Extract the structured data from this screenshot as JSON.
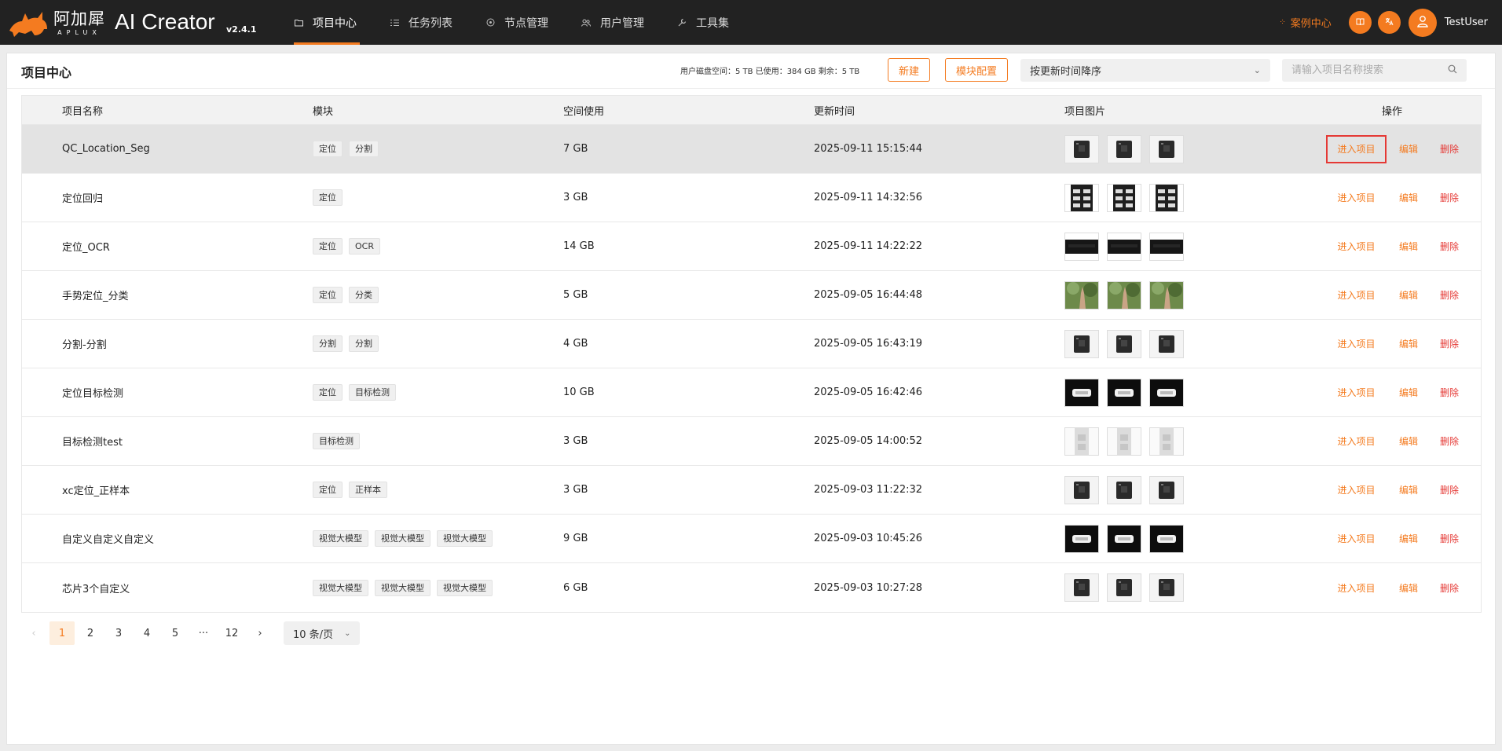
{
  "app": {
    "logo_cn": "阿加犀",
    "logo_en": "APLUX",
    "name": "AI Creator",
    "version": "v2.4.1"
  },
  "nav": [
    {
      "label": "项目中心",
      "icon": "folder-icon",
      "active": true
    },
    {
      "label": "任务列表",
      "icon": "list-icon",
      "active": false
    },
    {
      "label": "节点管理",
      "icon": "node-icon",
      "active": false
    },
    {
      "label": "用户管理",
      "icon": "users-icon",
      "active": false
    },
    {
      "label": "工具集",
      "icon": "wrench-icon",
      "active": false
    }
  ],
  "header_right": {
    "case_center": "案例中心",
    "username": "TestUser"
  },
  "page": {
    "title": "项目中心",
    "disk_info": "用户磁盘空间：5 TB  已使用：384 GB  剩余：5 TB",
    "new_button": "新建",
    "module_config_button": "模块配置",
    "sort_value": "按更新时间降序",
    "search_placeholder": "请输入项目名称搜索"
  },
  "table": {
    "headers": {
      "name": "项目名称",
      "modules": "模块",
      "space": "空间使用",
      "updated": "更新时间",
      "images": "项目图片",
      "actions": "操作"
    },
    "action_labels": {
      "enter": "进入项目",
      "edit": "编辑",
      "delete": "删除"
    },
    "rows": [
      {
        "name": "QC_Location_Seg",
        "modules": [
          "定位",
          "分割"
        ],
        "space": "7 GB",
        "updated": "2025-09-11 15:15:44",
        "thumb": "chip"
      },
      {
        "name": "定位回归",
        "modules": [
          "定位"
        ],
        "space": "3 GB",
        "updated": "2025-09-11 14:32:56",
        "thumb": "tray"
      },
      {
        "name": "定位_OCR",
        "modules": [
          "定位",
          "OCR"
        ],
        "space": "14 GB",
        "updated": "2025-09-11 14:22:22",
        "thumb": "dark"
      },
      {
        "name": "手势定位_分类",
        "modules": [
          "定位",
          "分类"
        ],
        "space": "5 GB",
        "updated": "2025-09-05 16:44:48",
        "thumb": "hand"
      },
      {
        "name": "分割-分割",
        "modules": [
          "分割",
          "分割"
        ],
        "space": "4 GB",
        "updated": "2025-09-05 16:43:19",
        "thumb": "chip"
      },
      {
        "name": "定位目标检测",
        "modules": [
          "定位",
          "目标检测"
        ],
        "space": "10 GB",
        "updated": "2025-09-05 16:42:46",
        "thumb": "label"
      },
      {
        "name": "目标检测test",
        "modules": [
          "目标检测"
        ],
        "space": "3 GB",
        "updated": "2025-09-05 14:00:52",
        "thumb": "pale"
      },
      {
        "name": "xc定位_正样本",
        "modules": [
          "定位",
          "正样本"
        ],
        "space": "3 GB",
        "updated": "2025-09-03 11:22:32",
        "thumb": "chip"
      },
      {
        "name": "自定义自定义自定义",
        "modules": [
          "视觉大模型",
          "视觉大模型",
          "视觉大模型"
        ],
        "space": "9 GB",
        "updated": "2025-09-03 10:45:26",
        "thumb": "label"
      },
      {
        "name": "芯片3个自定义",
        "modules": [
          "视觉大模型",
          "视觉大模型",
          "视觉大模型"
        ],
        "space": "6 GB",
        "updated": "2025-09-03 10:27:28",
        "thumb": "chip"
      }
    ]
  },
  "pagination": {
    "pages": [
      "1",
      "2",
      "3",
      "4",
      "5",
      "···",
      "12"
    ],
    "current": "1",
    "prev": "‹",
    "next": "›",
    "page_size": "10 条/页"
  },
  "colors": {
    "accent": "#f47b20",
    "danger": "#e53935",
    "topbar": "#222222"
  }
}
